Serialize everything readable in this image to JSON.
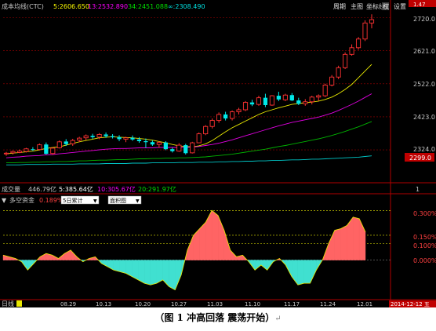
{
  "header": {
    "ma_label": "成本均线(CTC)",
    "ma5": "5:2606.650",
    "ma13": "13:2532.890",
    "ma34": "34:2451.088",
    "ma_long": "∞:2308.490",
    "toolbar": [
      "周期",
      "主图",
      "坐标线",
      "权",
      "设置"
    ],
    "corner": "1.47"
  },
  "price_axis": {
    "labels": [
      "2720.0",
      "2621.0",
      "2522.0",
      "2423.0",
      "2324.0"
    ],
    "current": "2299.0"
  },
  "volume": {
    "label": "成交量",
    "value": "446.79亿",
    "ma5": "5:385.64亿",
    "ma10": "10:305.67亿",
    "ma20": "20:291.97亿",
    "axis_label": "1"
  },
  "indicator": {
    "name": "多空资金",
    "value": "0.189%",
    "select1": "5日累计",
    "select2": "面积图",
    "axis": [
      "0.300%",
      "0.150%",
      "0.100%",
      "0.000%"
    ]
  },
  "date_axis": {
    "period": "日线",
    "dates": [
      "08.29",
      "10.13",
      "10.20",
      "10.27",
      "11.03",
      "11.10",
      "11.17",
      "11.24",
      "12.01"
    ],
    "current_date": "2014-12-12 五"
  },
  "chart_data": {
    "type": "candlestick",
    "ylim": [
      2270,
      2740
    ],
    "ohlc": [
      [
        2312,
        2318,
        2306,
        2314
      ],
      [
        2315,
        2322,
        2310,
        2319
      ],
      [
        2316,
        2325,
        2314,
        2320
      ],
      [
        2319,
        2330,
        2316,
        2327
      ],
      [
        2326,
        2332,
        2321,
        2324
      ],
      [
        2325,
        2343,
        2322,
        2339
      ],
      [
        2340,
        2346,
        2310,
        2312
      ],
      [
        2313,
        2332,
        2309,
        2329
      ],
      [
        2330,
        2352,
        2328,
        2348
      ],
      [
        2349,
        2356,
        2336,
        2341
      ],
      [
        2342,
        2357,
        2336,
        2352
      ],
      [
        2353,
        2363,
        2347,
        2359
      ],
      [
        2360,
        2370,
        2353,
        2366
      ],
      [
        2366,
        2372,
        2357,
        2362
      ],
      [
        2362,
        2374,
        2356,
        2370
      ],
      [
        2370,
        2376,
        2360,
        2365
      ],
      [
        2365,
        2371,
        2358,
        2362
      ],
      [
        2362,
        2368,
        2350,
        2356
      ],
      [
        2356,
        2363,
        2347,
        2360
      ],
      [
        2360,
        2367,
        2351,
        2355
      ],
      [
        2355,
        2362,
        2345,
        2350
      ],
      [
        2350,
        2358,
        2330,
        2347
      ],
      [
        2347,
        2352,
        2336,
        2340
      ],
      [
        2340,
        2350,
        2330,
        2346
      ],
      [
        2346,
        2350,
        2323,
        2326
      ],
      [
        2326,
        2330,
        2316,
        2320
      ],
      [
        2320,
        2344,
        2318,
        2338
      ],
      [
        2338,
        2342,
        2310,
        2314
      ],
      [
        2315,
        2348,
        2313,
        2345
      ],
      [
        2345,
        2376,
        2344,
        2372
      ],
      [
        2372,
        2398,
        2368,
        2394
      ],
      [
        2394,
        2418,
        2388,
        2412
      ],
      [
        2412,
        2436,
        2405,
        2430
      ],
      [
        2430,
        2438,
        2412,
        2418
      ],
      [
        2418,
        2442,
        2412,
        2438
      ],
      [
        2438,
        2450,
        2430,
        2444
      ],
      [
        2444,
        2470,
        2440,
        2466
      ],
      [
        2466,
        2474,
        2455,
        2460
      ],
      [
        2460,
        2486,
        2456,
        2480
      ],
      [
        2480,
        2492,
        2452,
        2458
      ],
      [
        2458,
        2488,
        2456,
        2486
      ],
      [
        2486,
        2498,
        2470,
        2475
      ],
      [
        2474,
        2492,
        2470,
        2488
      ],
      [
        2488,
        2494,
        2470,
        2472
      ],
      [
        2472,
        2480,
        2458,
        2462
      ],
      [
        2462,
        2476,
        2456,
        2468
      ],
      [
        2468,
        2486,
        2460,
        2482
      ],
      [
        2482,
        2490,
        2470,
        2486
      ],
      [
        2486,
        2522,
        2482,
        2518
      ],
      [
        2518,
        2548,
        2514,
        2542
      ],
      [
        2542,
        2576,
        2536,
        2570
      ],
      [
        2570,
        2616,
        2566,
        2610
      ],
      [
        2610,
        2640,
        2606,
        2630
      ],
      [
        2630,
        2662,
        2624,
        2656
      ],
      [
        2656,
        2712,
        2650,
        2704
      ],
      [
        2704,
        2730,
        2688,
        2714
      ]
    ],
    "series": [
      {
        "name": "5",
        "color": "#e8e800",
        "values": [
          2312,
          2314,
          2316,
          2318,
          2320,
          2324,
          2328,
          2331,
          2333,
          2338,
          2343,
          2348,
          2352,
          2356,
          2360,
          2362,
          2363,
          2362,
          2361,
          2360,
          2358,
          2356,
          2353,
          2349,
          2345,
          2340,
          2336,
          2334,
          2333,
          2336,
          2342,
          2352,
          2365,
          2378,
          2390,
          2400,
          2410,
          2420,
          2430,
          2438,
          2444,
          2450,
          2455,
          2460,
          2463,
          2465,
          2467,
          2470,
          2475,
          2482,
          2492,
          2505,
          2520,
          2540,
          2560,
          2580
        ]
      },
      {
        "name": "13",
        "color": "#e000e0",
        "values": [
          2300,
          2302,
          2303,
          2305,
          2306,
          2307,
          2309,
          2310,
          2312,
          2314,
          2316,
          2318,
          2320,
          2322,
          2324,
          2326,
          2327,
          2328,
          2328,
          2329,
          2330,
          2330,
          2330,
          2331,
          2331,
          2331,
          2331,
          2331,
          2332,
          2334,
          2337,
          2340,
          2344,
          2349,
          2354,
          2360,
          2366,
          2372,
          2378,
          2384,
          2390,
          2396,
          2401,
          2406,
          2410,
          2414,
          2418,
          2422,
          2428,
          2434,
          2442,
          2451,
          2460,
          2470,
          2481,
          2492
        ]
      },
      {
        "name": "34",
        "color": "#00b400",
        "values": [
          2285,
          2285,
          2286,
          2286,
          2287,
          2287,
          2288,
          2288,
          2289,
          2289,
          2290,
          2291,
          2291,
          2292,
          2293,
          2293,
          2294,
          2295,
          2295,
          2296,
          2297,
          2297,
          2298,
          2298,
          2299,
          2299,
          2300,
          2300,
          2301,
          2302,
          2303,
          2305,
          2307,
          2309,
          2311,
          2314,
          2317,
          2320,
          2323,
          2326,
          2330,
          2334,
          2337,
          2341,
          2345,
          2349,
          2353,
          2357,
          2362,
          2367,
          2373,
          2379,
          2386,
          2393,
          2401,
          2409
        ]
      },
      {
        "name": "∞",
        "color": "#00c8c8",
        "values": [
          2279,
          2279,
          2279,
          2280,
          2280,
          2280,
          2280,
          2281,
          2281,
          2281,
          2281,
          2282,
          2282,
          2282,
          2282,
          2283,
          2283,
          2283,
          2283,
          2284,
          2284,
          2284,
          2285,
          2285,
          2285,
          2285,
          2286,
          2286,
          2286,
          2287,
          2287,
          2287,
          2288,
          2288,
          2289,
          2289,
          2290,
          2290,
          2291,
          2291,
          2292,
          2292,
          2293,
          2294,
          2294,
          2295,
          2296,
          2296,
          2297,
          2298,
          2299,
          2300,
          2301,
          2302,
          2304,
          2306
        ]
      }
    ],
    "money_flow": {
      "ylim": [
        -0.22,
        0.33
      ],
      "values": [
        0.03,
        0.02,
        0.01,
        -0.01,
        -0.06,
        -0.02,
        0.02,
        0.04,
        0.03,
        0.01,
        0.04,
        0.06,
        0.02,
        -0.01,
        0.01,
        0.02,
        -0.02,
        -0.04,
        -0.06,
        -0.07,
        -0.08,
        -0.1,
        -0.12,
        -0.14,
        -0.15,
        -0.14,
        -0.12,
        -0.16,
        -0.18,
        -0.09,
        0.06,
        0.15,
        0.19,
        0.23,
        0.3,
        0.27,
        0.18,
        0.06,
        0.02,
        0.03,
        -0.01,
        -0.06,
        -0.03,
        -0.06,
        -0.01,
        0.01,
        -0.03,
        -0.1,
        -0.15,
        -0.14,
        -0.14,
        -0.06,
        0.0,
        0.1,
        0.18,
        0.19,
        0.21,
        0.26,
        0.25,
        0.17
      ]
    }
  },
  "caption": {
    "text": "（图 1  冲高回落  震荡开始）",
    "mark": "↵"
  }
}
